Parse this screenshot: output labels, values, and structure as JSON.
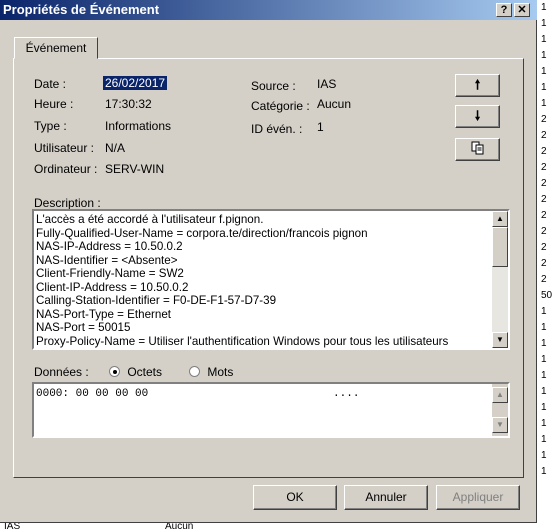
{
  "window": {
    "title": "Propriétés de Événement",
    "help_btn": "?",
    "close_btn": "✕"
  },
  "tab": {
    "label": "Événement"
  },
  "fields": {
    "date_label": "Date :",
    "date_value": "26/02/2017",
    "time_label": "Heure :",
    "time_value": "17:30:32",
    "type_label": "Type :",
    "type_value": "Informations",
    "user_label": "Utilisateur :",
    "user_value": "N/A",
    "computer_label": "Ordinateur :",
    "computer_value": "SERV-WIN",
    "source_label": "Source :",
    "source_value": "IAS",
    "category_label": "Catégorie :",
    "category_value": "Aucun",
    "id_label": "ID évén. :",
    "id_value": "1"
  },
  "description": {
    "label": "Description :",
    "lines": [
      "L'accès a été accordé à l'utilisateur f.pignon.",
      "Fully-Qualified-User-Name = corpora.te/direction/francois pignon",
      "NAS-IP-Address = 10.50.0.2",
      "NAS-Identifier = <Absente>",
      "Client-Friendly-Name = SW2",
      "Client-IP-Address = 10.50.0.2",
      "Calling-Station-Identifier = F0-DE-F1-57-D7-39",
      "NAS-Port-Type = Ethernet",
      "NAS-Port = 50015",
      "Proxy-Policy-Name = Utiliser l'authentification Windows pour tous les utilisateurs"
    ]
  },
  "data_section": {
    "label": "Données :",
    "radio_bytes": "Octets",
    "radio_words": "Mots",
    "selected": "Octets",
    "content": "0000: 00 00 00 00                            ...."
  },
  "buttons": {
    "ok": "OK",
    "cancel": "Annuler",
    "apply": "Appliquer"
  },
  "side_icons": {
    "up": "up-arrow-icon",
    "down": "down-arrow-icon",
    "copy": "copy-icon"
  },
  "background_list": [
    "1",
    "1",
    "1",
    "1",
    "1",
    "1",
    "1",
    "2",
    "2",
    "2",
    "2",
    "2",
    "2",
    "2",
    "2",
    "2",
    "2",
    "2",
    "50",
    "1",
    "1",
    "1",
    "1",
    "1",
    "1",
    "1",
    "1",
    "1",
    "1",
    "1"
  ],
  "background_row": {
    "source": "IAS",
    "category": "Aucun"
  }
}
